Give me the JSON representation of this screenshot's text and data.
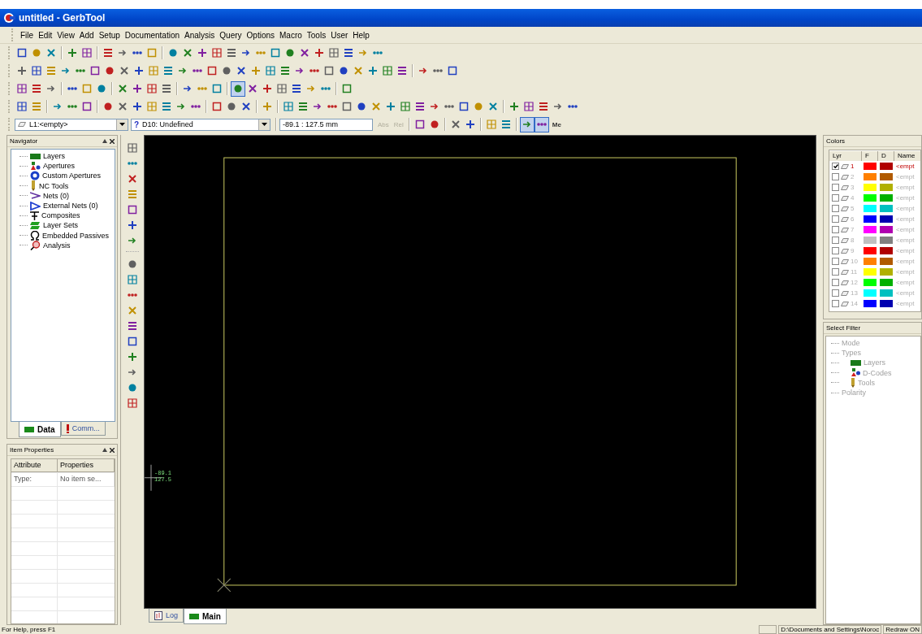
{
  "window": {
    "title": "untitled - GerbTool"
  },
  "menu": [
    "File",
    "Edit",
    "View",
    "Add",
    "Setup",
    "Documentation",
    "Analysis",
    "Query",
    "Options",
    "Macro",
    "Tools",
    "User",
    "Help"
  ],
  "toolbars": [
    {
      "groups": [
        [
          {
            "pressed": false
          },
          {
            "pressed": false
          },
          {
            "pressed": false
          }
        ],
        [
          {
            "pressed": false
          },
          {
            "pressed": false
          }
        ],
        [
          {
            "pressed": false
          },
          {
            "pressed": false
          },
          {
            "pressed": false
          },
          {
            "pressed": false
          }
        ],
        [
          {
            "pressed": false
          },
          {
            "pressed": false
          },
          {
            "pressed": false
          },
          {
            "pressed": false
          },
          {
            "pressed": false
          },
          {
            "pressed": false
          },
          {
            "pressed": false
          },
          {
            "pressed": false
          },
          {
            "pressed": false
          },
          {
            "pressed": false
          },
          {
            "pressed": false
          },
          {
            "pressed": false
          },
          {
            "pressed": false
          },
          {
            "pressed": false
          },
          {
            "pressed": false
          }
        ]
      ]
    },
    {
      "groups": [
        [
          {
            "pressed": false
          },
          {
            "pressed": false
          },
          {
            "pressed": false
          },
          {
            "pressed": false
          },
          {
            "pressed": false
          },
          {
            "pressed": false
          },
          {
            "pressed": false
          },
          {
            "pressed": false
          },
          {
            "pressed": false
          },
          {
            "pressed": false
          },
          {
            "pressed": false
          },
          {
            "pressed": false
          },
          {
            "pressed": false
          },
          {
            "pressed": false
          },
          {
            "pressed": false
          },
          {
            "pressed": false
          },
          {
            "pressed": false
          },
          {
            "pressed": false
          },
          {
            "pressed": false
          },
          {
            "pressed": false
          },
          {
            "pressed": false
          },
          {
            "pressed": false
          },
          {
            "pressed": false
          },
          {
            "pressed": false
          },
          {
            "pressed": false
          },
          {
            "pressed": false
          },
          {
            "pressed": false
          }
        ],
        [
          {
            "pressed": false
          },
          {
            "pressed": false
          },
          {
            "pressed": false
          }
        ]
      ]
    },
    {
      "groups": [
        [
          {
            "pressed": false
          },
          {
            "pressed": false
          },
          {
            "pressed": false
          }
        ],
        [
          {
            "pressed": false
          },
          {
            "pressed": false
          },
          {
            "pressed": false
          }
        ],
        [
          {
            "pressed": false
          },
          {
            "pressed": false
          },
          {
            "pressed": false
          },
          {
            "pressed": false
          }
        ],
        [
          {
            "pressed": false
          },
          {
            "pressed": false
          },
          {
            "pressed": false
          }
        ],
        [
          {
            "pressed": true
          },
          {
            "pressed": false
          },
          {
            "pressed": false
          },
          {
            "pressed": false
          },
          {
            "pressed": false
          },
          {
            "pressed": false
          },
          {
            "pressed": false
          }
        ],
        [
          {
            "pressed": false
          }
        ]
      ]
    },
    {
      "groups": [
        [
          {
            "pressed": false
          },
          {
            "pressed": false
          }
        ],
        [
          {
            "pressed": false
          },
          {
            "pressed": false
          },
          {
            "pressed": false
          }
        ],
        [
          {
            "pressed": false
          },
          {
            "pressed": false
          },
          {
            "pressed": false
          },
          {
            "pressed": false
          },
          {
            "pressed": false
          },
          {
            "pressed": false
          },
          {
            "pressed": false
          }
        ],
        [
          {
            "pressed": false
          },
          {
            "pressed": false
          },
          {
            "pressed": false
          }
        ],
        [
          {
            "pressed": false
          }
        ],
        [
          {
            "pressed": false
          },
          {
            "pressed": false
          },
          {
            "pressed": false
          },
          {
            "pressed": false
          },
          {
            "pressed": false
          },
          {
            "pressed": false
          },
          {
            "pressed": false
          },
          {
            "pressed": false
          },
          {
            "pressed": false
          },
          {
            "pressed": false
          },
          {
            "pressed": false
          },
          {
            "pressed": false
          },
          {
            "pressed": false
          },
          {
            "pressed": false
          },
          {
            "pressed": false
          }
        ],
        [
          {
            "pressed": false
          },
          {
            "pressed": false
          },
          {
            "pressed": false
          },
          {
            "pressed": false
          },
          {
            "pressed": false
          }
        ]
      ]
    }
  ],
  "combo_bar": {
    "layer_combo": "L1:<empty>",
    "dcode_marker": "?",
    "dcode_combo": "D10: Undefined",
    "coordinate_field": "-89.1 : 127.5 mm",
    "mode_buttons": [
      {
        "label": "Abs",
        "disabled": true
      },
      {
        "label": "Rel",
        "disabled": true
      }
    ],
    "groups": [
      [
        {
          "pressed": false
        },
        {
          "pressed": false
        }
      ],
      [
        {
          "pressed": false
        },
        {
          "pressed": false
        }
      ],
      [
        {
          "pressed": false
        },
        {
          "pressed": false
        }
      ],
      [
        {
          "pressed": true
        },
        {
          "pressed": true
        }
      ]
    ],
    "tail_label": "Me"
  },
  "navigator": {
    "title": "Navigator",
    "items": [
      "Layers",
      "Apertures",
      "Custom Apertures",
      "NC Tools",
      "Nets (0)",
      "External Nets (0)",
      "Composites",
      "Layer Sets",
      "Embedded Passives",
      "Analysis"
    ],
    "tabs": [
      {
        "label": "Data",
        "selected": true
      },
      {
        "label": "Comm...",
        "selected": false
      }
    ]
  },
  "item_properties": {
    "title": "Item Properties",
    "columns": [
      "Attribute",
      "Properties"
    ],
    "rows": [
      [
        "Type:",
        "No item se..."
      ]
    ]
  },
  "canvas": {
    "cursor_readout": [
      "-89.1",
      "127.5"
    ],
    "tabs": [
      {
        "label": "Log",
        "selected": false
      },
      {
        "label": "Main",
        "selected": true
      }
    ]
  },
  "colors": {
    "title": "Colors",
    "columns": [
      "Lyr",
      "F",
      "D",
      "Name"
    ],
    "layers": [
      {
        "number": "1",
        "checked": true,
        "active": true,
        "swatches": [
          {
            "color": "#ff0000"
          },
          {
            "color": "#b00000"
          }
        ],
        "name": "<empt"
      },
      {
        "number": "2",
        "checked": false,
        "active": false,
        "swatches": [
          {
            "color": "#ff8000"
          },
          {
            "color": "#b05a00"
          }
        ],
        "name": "<empt"
      },
      {
        "number": "3",
        "checked": false,
        "active": false,
        "swatches": [
          {
            "color": "#ffff00"
          },
          {
            "color": "#b0b000"
          }
        ],
        "name": "<empt"
      },
      {
        "number": "4",
        "checked": false,
        "active": false,
        "swatches": [
          {
            "color": "#00ff00"
          },
          {
            "color": "#00b000"
          }
        ],
        "name": "<empt"
      },
      {
        "number": "5",
        "checked": false,
        "active": false,
        "swatches": [
          {
            "color": "#00ffff"
          },
          {
            "color": "#00c0c0"
          }
        ],
        "name": "<empt"
      },
      {
        "number": "6",
        "checked": false,
        "active": false,
        "swatches": [
          {
            "color": "#0000ff"
          },
          {
            "color": "#0000b0"
          }
        ],
        "name": "<empt"
      },
      {
        "number": "7",
        "checked": false,
        "active": false,
        "swatches": [
          {
            "color": "#ff00ff"
          },
          {
            "color": "#b000b0"
          }
        ],
        "name": "<empt"
      },
      {
        "number": "8",
        "checked": false,
        "active": false,
        "swatches": [
          {
            "color": "#c0c0c0"
          },
          {
            "color": "#808080"
          }
        ],
        "name": "<empt"
      },
      {
        "number": "9",
        "checked": false,
        "active": false,
        "swatches": [
          {
            "color": "#ff0000"
          },
          {
            "color": "#b00000"
          }
        ],
        "name": "<empt"
      },
      {
        "number": "10",
        "checked": false,
        "active": false,
        "swatches": [
          {
            "color": "#ff8000"
          },
          {
            "color": "#b05a00"
          }
        ],
        "name": "<empt"
      },
      {
        "number": "11",
        "checked": false,
        "active": false,
        "swatches": [
          {
            "color": "#ffff00"
          },
          {
            "color": "#b0b000"
          }
        ],
        "name": "<empt"
      },
      {
        "number": "12",
        "checked": false,
        "active": false,
        "swatches": [
          {
            "color": "#00ff00"
          },
          {
            "color": "#00b000"
          }
        ],
        "name": "<empt"
      },
      {
        "number": "13",
        "checked": false,
        "active": false,
        "swatches": [
          {
            "color": "#00ffff"
          },
          {
            "color": "#00c0c0"
          }
        ],
        "name": "<empt"
      },
      {
        "number": "14",
        "checked": false,
        "active": false,
        "swatches": [
          {
            "color": "#0000ff"
          },
          {
            "color": "#0000b0"
          }
        ],
        "name": "<empt"
      }
    ]
  },
  "select_filter": {
    "title": "Select Filter",
    "items": [
      {
        "label": "Mode",
        "disabled": true,
        "kind": "plain"
      },
      {
        "label": "Types",
        "disabled": true,
        "kind": "plain"
      },
      {
        "label": "Layers",
        "disabled": true,
        "kind": "layers"
      },
      {
        "label": "D-Codes",
        "disabled": true,
        "kind": "dcodes"
      },
      {
        "label": "Tools",
        "disabled": true,
        "kind": "tools"
      },
      {
        "label": "Polarity",
        "disabled": true,
        "kind": "plain"
      }
    ]
  },
  "status_bar": {
    "help": "For Help, press F1",
    "path": "D:\\Documents and Settings\\Noroc",
    "redraw": "Redraw ON"
  }
}
